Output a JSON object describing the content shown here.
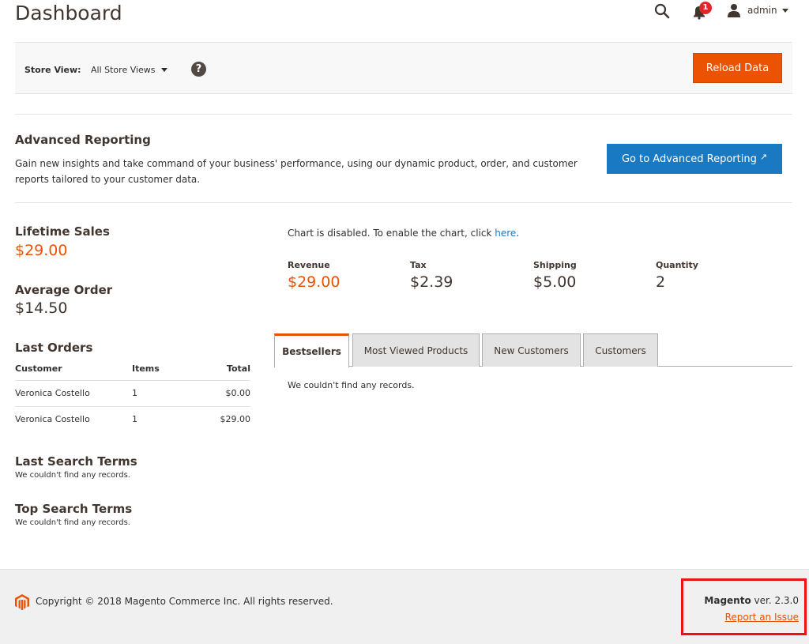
{
  "header": {
    "title": "Dashboard",
    "notifications_count": "1",
    "user_name": "admin"
  },
  "store_bar": {
    "label": "Store View:",
    "selected": "All Store Views",
    "help": "?",
    "reload_label": "Reload Data"
  },
  "advanced": {
    "title": "Advanced Reporting",
    "description": "Gain new insights and take command of your business' performance, using our dynamic product, order, and customer reports tailored to your customer data.",
    "button_label": "Go to Advanced Reporting",
    "button_icon": "↗"
  },
  "stats": {
    "lifetime_label": "Lifetime Sales",
    "lifetime_value": "$29.00",
    "average_label": "Average Order",
    "average_value": "$14.50"
  },
  "last_orders": {
    "title": "Last Orders",
    "headers": [
      "Customer",
      "Items",
      "Total"
    ],
    "rows": [
      [
        "Veronica Costello",
        "1",
        "$0.00"
      ],
      [
        "Veronica Costello",
        "1",
        "$29.00"
      ]
    ]
  },
  "search_terms": {
    "last_title": "Last Search Terms",
    "last_empty": "We couldn't find any records.",
    "top_title": "Top Search Terms",
    "top_empty": "We couldn't find any records."
  },
  "chart": {
    "message": "Chart is disabled. To enable the chart, click ",
    "link": "here",
    "message_end": "."
  },
  "totals": {
    "revenue_label": "Revenue",
    "revenue_value": "$29.00",
    "tax_label": "Tax",
    "tax_value": "$2.39",
    "shipping_label": "Shipping",
    "shipping_value": "$5.00",
    "quantity_label": "Quantity",
    "quantity_value": "2"
  },
  "tabs": {
    "items": [
      "Bestsellers",
      "Most Viewed Products",
      "New Customers",
      "Customers"
    ],
    "content": "We couldn't find any records."
  },
  "footer": {
    "copyright": "Copyright © 2018 Magento Commerce Inc. All rights reserved.",
    "brand": "Magento",
    "version": " ver. 2.3.0",
    "report_link": "Report an Issue"
  },
  "colors": {
    "accent": "#eb5202",
    "primary": "#1979c3",
    "highlight": "#ee1111"
  }
}
